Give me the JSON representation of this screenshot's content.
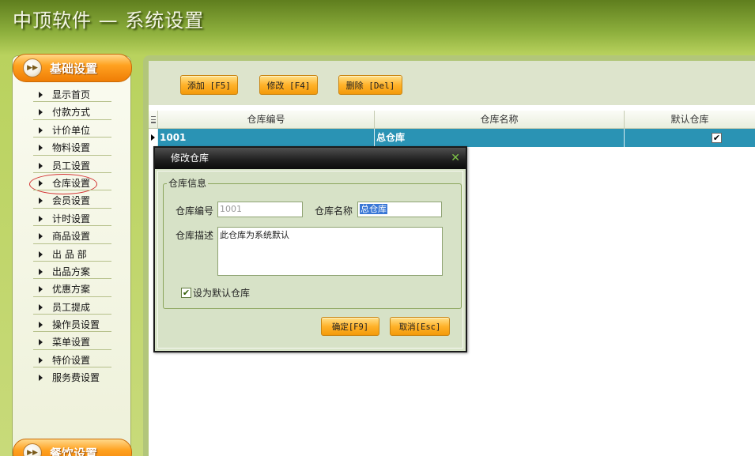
{
  "app": {
    "title": "中顶软件 — 系统设置"
  },
  "sidebar": {
    "section_title": "基础设置",
    "items": [
      {
        "label": "显示首页"
      },
      {
        "label": "付款方式"
      },
      {
        "label": "计价单位"
      },
      {
        "label": "物料设置"
      },
      {
        "label": "员工设置"
      },
      {
        "label": "仓库设置",
        "selected": true
      },
      {
        "label": "会员设置"
      },
      {
        "label": "计时设置"
      },
      {
        "label": "商品设置"
      },
      {
        "label": "出 品 部"
      },
      {
        "label": "出品方案"
      },
      {
        "label": "优惠方案"
      },
      {
        "label": "员工提成"
      },
      {
        "label": "操作员设置"
      },
      {
        "label": "菜单设置"
      },
      {
        "label": "特价设置"
      },
      {
        "label": "服务费设置"
      }
    ],
    "next_section_title": "餐饮设置"
  },
  "toolbar": {
    "add_label": "添加 [F5]",
    "edit_label": "修改 [F4]",
    "delete_label": "删除 [Del]"
  },
  "grid": {
    "columns": [
      "仓库编号",
      "仓库名称",
      "默认仓库"
    ],
    "rows": [
      {
        "code": "1001",
        "name": "总仓库",
        "default": true
      }
    ]
  },
  "dialog": {
    "title": "修改仓库",
    "group_title": "仓库信息",
    "code_label": "仓库编号",
    "code_value": "1001",
    "name_label": "仓库名称",
    "name_value": "总仓库",
    "desc_label": "仓库描述",
    "desc_value": "此仓库为系统默认",
    "default_label": "设为默认仓库",
    "default_checked": true,
    "confirm_label": "确定[F9]",
    "cancel_label": "取消[Esc]"
  },
  "colors": {
    "accent_orange": "#f49a0a",
    "selection_blue": "#2a93b4",
    "panel_green": "#b2c67a"
  }
}
